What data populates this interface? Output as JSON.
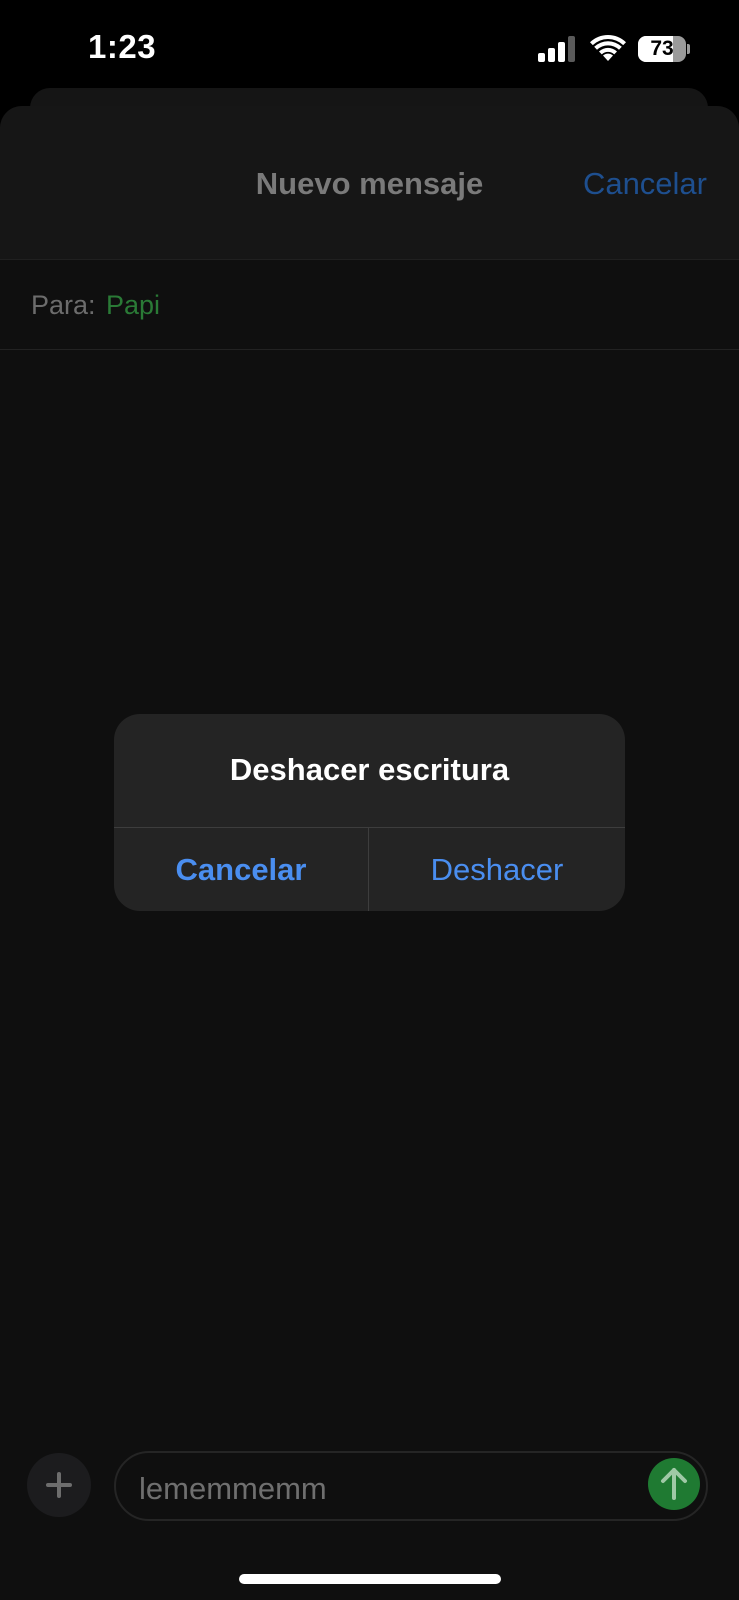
{
  "status_bar": {
    "time": "1:23",
    "battery_percent": "73",
    "battery_level": 0.73,
    "signal_bars": 3,
    "signal_icon": "cellular-signal-icon",
    "wifi_icon": "wifi-icon"
  },
  "header": {
    "title": "Nuevo mensaje",
    "cancel_label": "Cancelar"
  },
  "recipient": {
    "label": "Para:",
    "value": "Papi"
  },
  "compose": {
    "plus_icon": "plus-icon",
    "text": "lememmemm",
    "send_icon": "arrow-up-icon"
  },
  "alert": {
    "title": "Deshacer escritura",
    "cancel_label": "Cancelar",
    "confirm_label": "Deshacer"
  },
  "colors": {
    "accent_blue": "#4a8ef0",
    "recipient_green": "#2a7a36",
    "send_green": "#1f7a32",
    "background": "#0f0f0f"
  }
}
